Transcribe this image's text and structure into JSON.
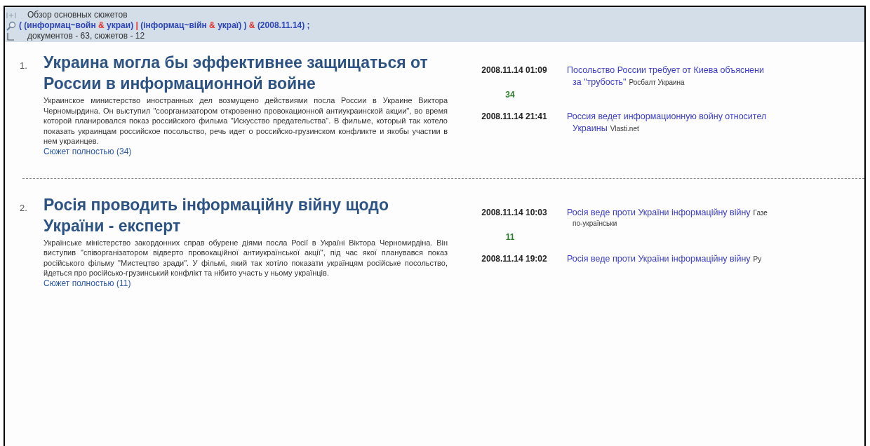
{
  "header": {
    "title": "Обзор основных сюжетов",
    "query": [
      {
        "kind": "term",
        "text": "( (информац~войн"
      },
      {
        "kind": "op",
        "text": "&"
      },
      {
        "kind": "term",
        "text": "украи)"
      },
      {
        "kind": "op",
        "text": "|"
      },
      {
        "kind": "term",
        "text": "(інформац~війн"
      },
      {
        "kind": "op",
        "text": "&"
      },
      {
        "kind": "term",
        "text": "украї) )"
      },
      {
        "kind": "op",
        "text": "&"
      },
      {
        "kind": "term",
        "text": "(2008.11.14) ;"
      }
    ],
    "counts": "документов - 63, сюжетов - 12"
  },
  "stories": [
    {
      "number": "1.",
      "title": "Украина могла бы эффективнее защищаться от России в информационной войне",
      "summary": "Украинское министерство иностранных дел возмущено действиями посла России в Украине Виктора Черномырдина. Он выступил \"соорганизатором откровенно провокационной антиукраинской акции\", во время которой планировался показ российского фильма \"Искусство предательства\". В фильме, который так хотело показать украинцам российское посольство, речь идет о российско-грузинском конфликте и якобы участии в нем украинцев.",
      "more_link": "Сюжет полностью (34)",
      "doc_count": "34",
      "headlines": [
        {
          "date": "2008.11.14 01:09",
          "lines": [
            [
              {
                "kind": "link",
                "text": "Посольство России требует от Киева объяснени"
              }
            ],
            [
              {
                "kind": "link",
                "text": "за \"трубость\""
              },
              {
                "kind": "source",
                "text": "Росбалт Украина"
              }
            ]
          ]
        },
        {
          "date": "2008.11.14 21:41",
          "lines": [
            [
              {
                "kind": "link",
                "text": "Россия ведет информационную войну относител"
              }
            ],
            [
              {
                "kind": "link",
                "text": "Украины"
              },
              {
                "kind": "source",
                "text": "Vlasti.net"
              }
            ]
          ]
        }
      ]
    },
    {
      "number": "2.",
      "title": "Росія проводить інформаційну війну щодо України - експерт",
      "summary": "Українське міністерство закордонних справ обурене діями посла Росії в Україні Віктора Черномирдіна. Він виступив \"співорганізатором відверто провокаційної антиукраїнської акції\", під час якої планувався показ російського фільму \"Мистецтво зради\". У фільмі, який так хотіло показати українцям російське посольство, йдеться про російсько-грузинський конфлікт та нібито участь у ньому українців.",
      "more_link": "Сюжет полностью (11)",
      "doc_count": "11",
      "headlines": [
        {
          "date": "2008.11.14 10:03",
          "lines": [
            [
              {
                "kind": "link",
                "text": "Росія веде проти України інформаційну війну"
              },
              {
                "kind": "source",
                "text": "Газе"
              }
            ],
            [
              {
                "kind": "source",
                "text": "по-українськи"
              }
            ]
          ]
        },
        {
          "date": "2008.11.14 19:02",
          "lines": [
            [
              {
                "kind": "link",
                "text": "Росія веде проти України інформаційну війну"
              },
              {
                "kind": "source",
                "text": "Ру"
              }
            ]
          ]
        }
      ]
    }
  ]
}
